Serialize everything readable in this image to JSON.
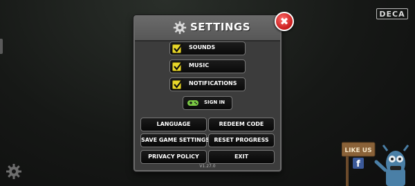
{
  "brand": {
    "logo": "DECA"
  },
  "settings": {
    "title": "SETTINGS",
    "toggles": [
      {
        "label": "SOUNDS",
        "checked": true
      },
      {
        "label": "MUSIC",
        "checked": true
      },
      {
        "label": "NOTIFICATIONS",
        "checked": true
      }
    ],
    "sign_in": "SIGN IN",
    "buttons": {
      "language": "LANGUAGE",
      "redeem": "REDEEM CODE",
      "save": "SAVE GAME SETTINGS",
      "reset": "RESET PROGRESS",
      "privacy": "PRIVACY POLICY",
      "exit": "EXIT"
    },
    "version": "V1.27.0"
  },
  "social": {
    "sign_text": "LIKE US"
  },
  "colors": {
    "check_yellow": "#e8d72a",
    "close_red": "#d42020",
    "controller_green": "#7ac943"
  }
}
